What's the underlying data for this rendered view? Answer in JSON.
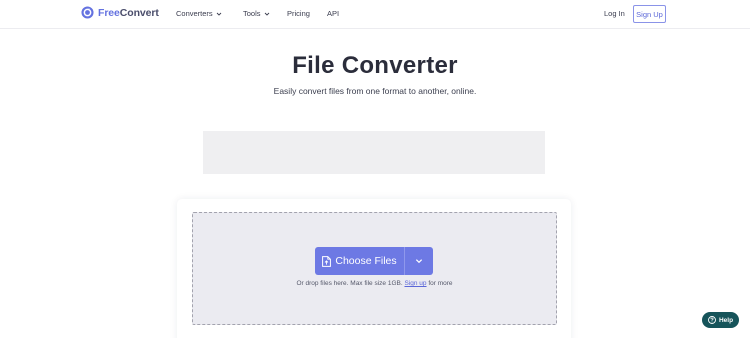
{
  "header": {
    "logo": {
      "part1": "Free",
      "part2": "Convert"
    },
    "nav": [
      {
        "label": "Converters",
        "dropdown": true
      },
      {
        "label": "Tools",
        "dropdown": true
      },
      {
        "label": "Pricing",
        "dropdown": false
      },
      {
        "label": "API",
        "dropdown": false
      }
    ],
    "login_label": "Log In",
    "signup_label": "Sign Up"
  },
  "hero": {
    "title": "File Converter",
    "subtitle": "Easily convert files from one format to another, online."
  },
  "upload": {
    "choose_label": "Choose Files",
    "hint_prefix": "Or drop files here. Max file size 1GB.",
    "hint_link": "Sign up",
    "hint_suffix": "for more"
  },
  "help": {
    "label": "Help"
  },
  "colors": {
    "brand": "#6472e0",
    "button": "#6d79e4",
    "dropzone_bg": "#ebebf1",
    "help_bg": "#16545a"
  },
  "icons": [
    "logo-icon",
    "chevron-down-icon",
    "file-icon",
    "help-icon"
  ]
}
